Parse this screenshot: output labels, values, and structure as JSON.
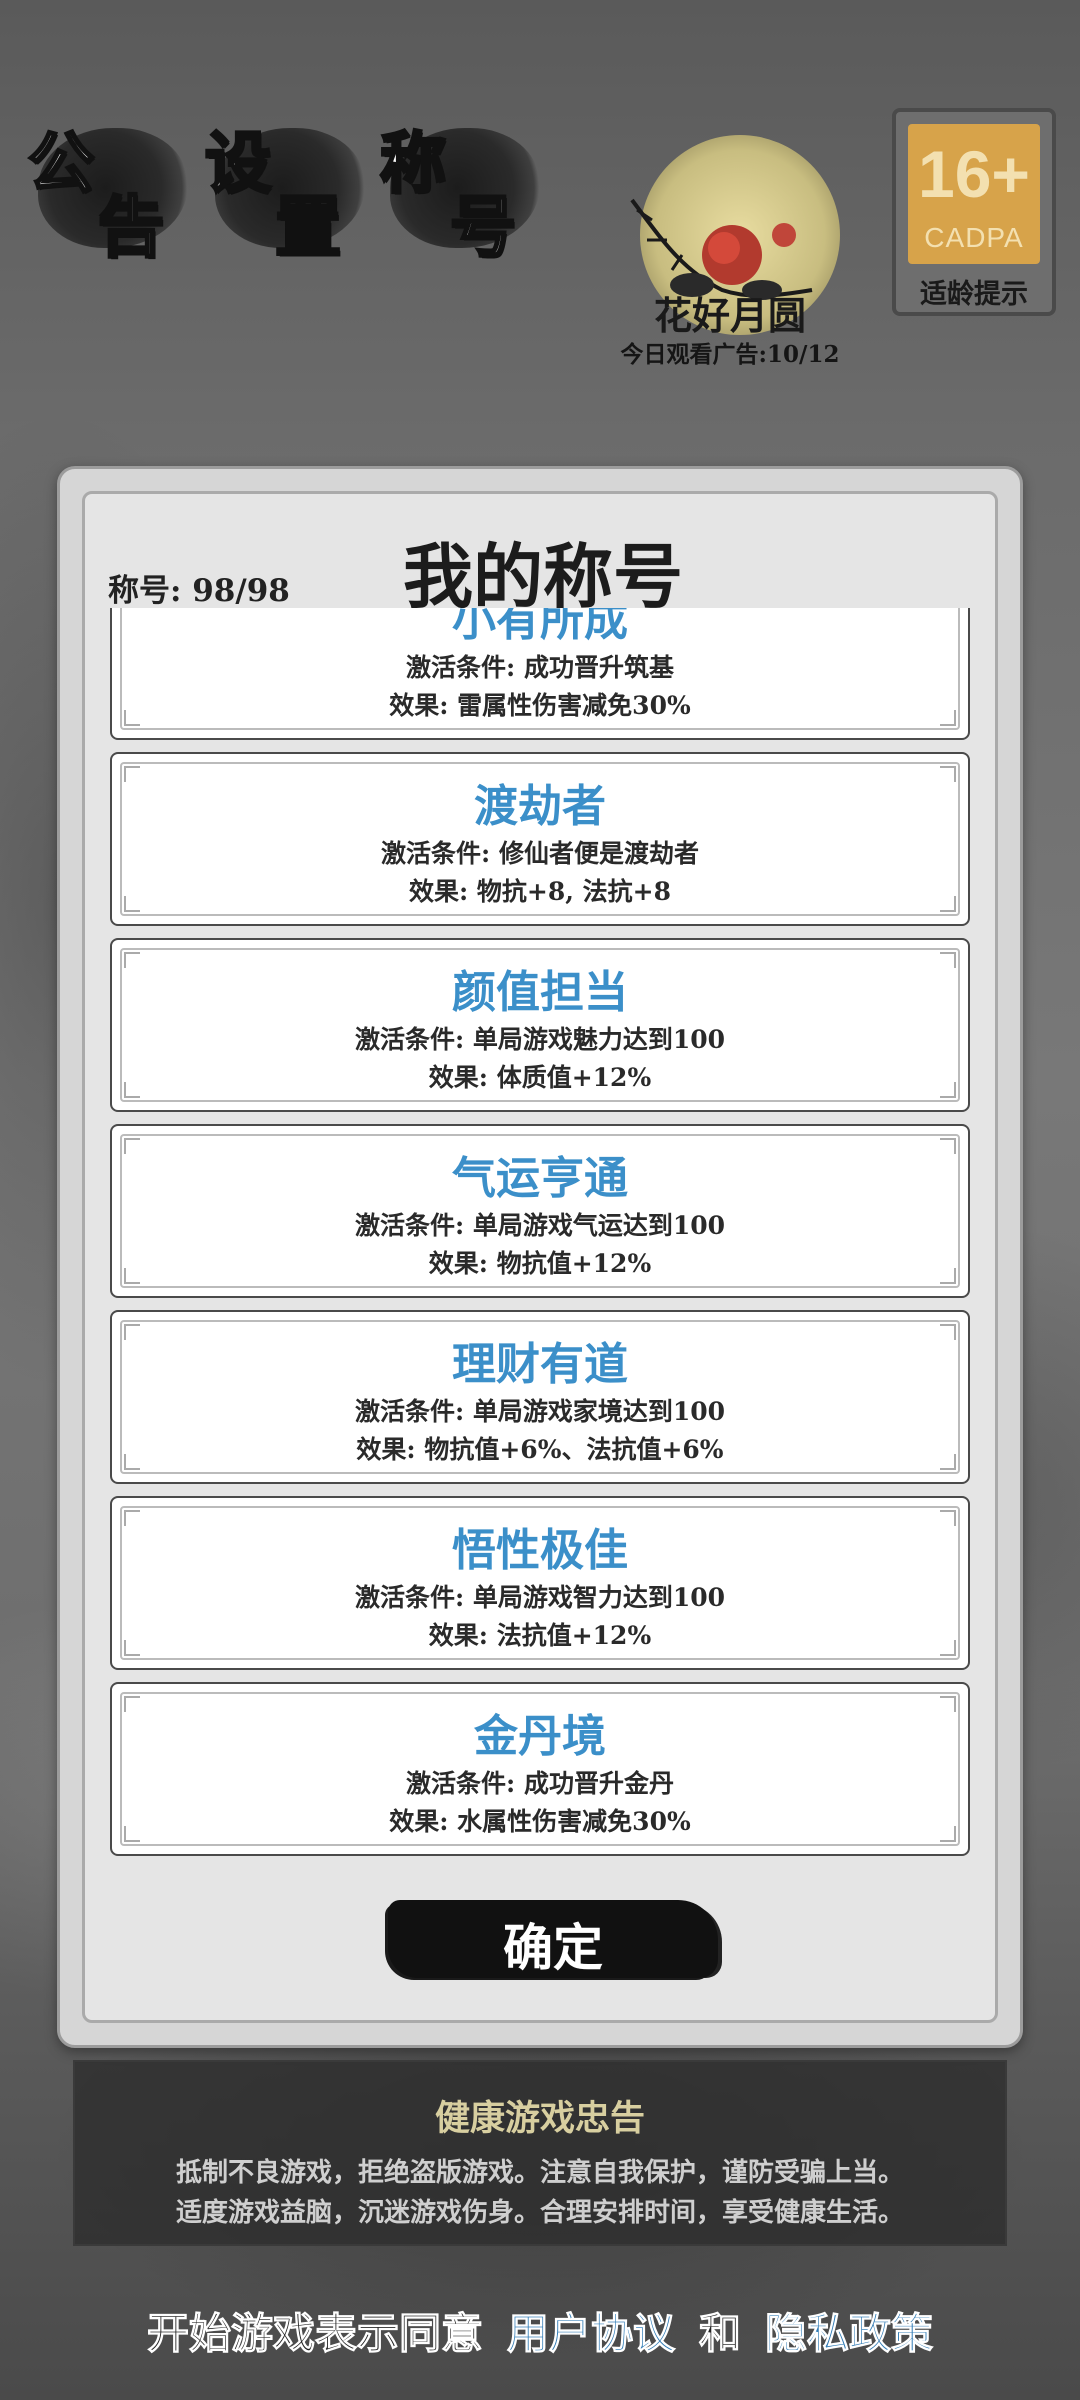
{
  "top_buttons": [
    {
      "id": "announcement",
      "chars": [
        "公",
        "告"
      ]
    },
    {
      "id": "settings",
      "chars": [
        "设",
        "置"
      ]
    },
    {
      "id": "titles",
      "chars": [
        "称",
        "号"
      ]
    }
  ],
  "event": {
    "title": "花好月圆",
    "ad_count": "今日观看广告:10/12"
  },
  "age_rating": {
    "number": "16+",
    "org": "CADPA",
    "tip": "适龄提示"
  },
  "panel": {
    "title": "我的称号",
    "count": "称号: 98/98",
    "confirm_label": "确定",
    "cards": [
      {
        "name": "小有所成",
        "condition": "激活条件: 成功晋升筑基",
        "effect": "效果: 雷属性伤害减免30%"
      },
      {
        "name": "渡劫者",
        "condition": "激活条件: 修仙者便是渡劫者",
        "effect": "效果: 物抗+8, 法抗+8"
      },
      {
        "name": "颜值担当",
        "condition": "激活条件: 单局游戏魅力达到100",
        "effect": "效果: 体质值+12%"
      },
      {
        "name": "气运亨通",
        "condition": "激活条件: 单局游戏气运达到100",
        "effect": "效果: 物抗值+12%"
      },
      {
        "name": "理财有道",
        "condition": "激活条件: 单局游戏家境达到100",
        "effect": "效果: 物抗值+6%、法抗值+6%"
      },
      {
        "name": "悟性极佳",
        "condition": "激活条件: 单局游戏智力达到100",
        "effect": "效果: 法抗值+12%"
      },
      {
        "name": "金丹境",
        "condition": "激活条件: 成功晋升金丹",
        "effect": "效果: 水属性伤害减免30%"
      }
    ]
  },
  "health_notice": {
    "title": "健康游戏忠告",
    "line1": "抵制不良游戏，拒绝盗版游戏。注意自我保护，谨防受骗上当。",
    "line2": "适度游戏益脑，沉迷游戏伤身。合理安排时间，享受健康生活。"
  },
  "agreement": {
    "prefix": "开始游戏表示同意",
    "user_agreement": "用户协议",
    "and": "和",
    "privacy_policy": "隐私政策"
  },
  "colors": {
    "title_blue": "#3b8fc9",
    "link_blue": "#2e7ab5",
    "badge_gold": "#d7a34a"
  }
}
